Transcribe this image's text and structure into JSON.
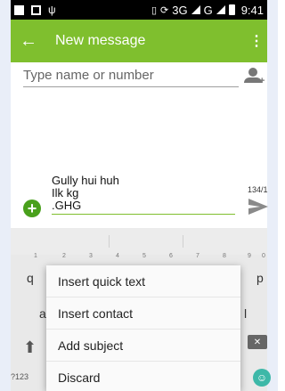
{
  "status_bar": {
    "signal_label": "3G",
    "network_label": "G",
    "time": "9:41"
  },
  "app_bar": {
    "title": "New message",
    "back_icon": "arrow-left-icon",
    "overflow_icon": "more-vert-icon",
    "color": "#7fbf2e"
  },
  "recipient": {
    "placeholder": "Type name or number",
    "value": ""
  },
  "compose": {
    "lines": [
      "Gully hui huh",
      "Ilk kg",
      ".GHG"
    ],
    "char_count": "134/1",
    "accent": "#7fbf2e"
  },
  "keyboard": {
    "top_row_keys": [
      "q",
      "p"
    ],
    "number_hints": [
      "1",
      "2",
      "3",
      "4",
      "5",
      "6",
      "7",
      "8",
      "9",
      "0"
    ],
    "second_row_edge_keys": [
      "a",
      "l"
    ],
    "sym_label": "?123",
    "emoji_icon": "smiley-icon"
  },
  "menu": {
    "items": [
      "Insert quick text",
      "Insert contact",
      "Add subject",
      "Discard"
    ]
  }
}
